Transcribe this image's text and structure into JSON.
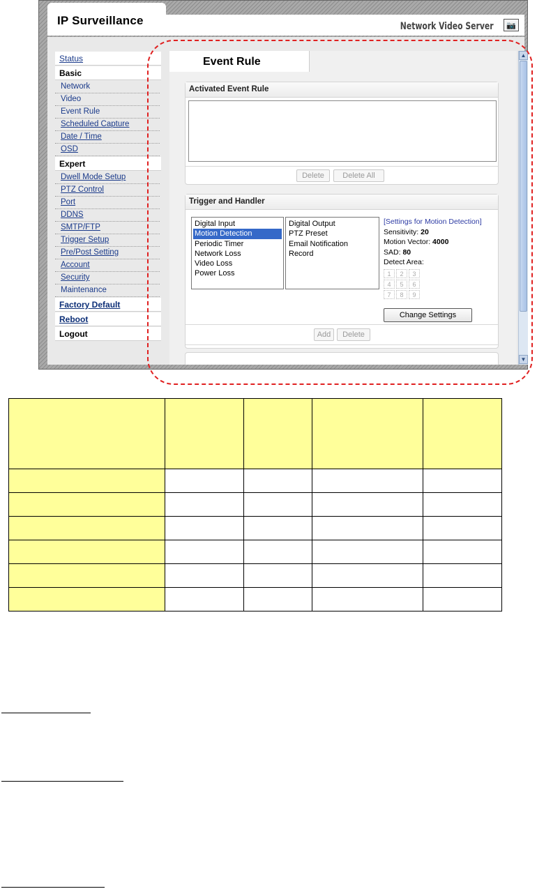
{
  "app": {
    "title": "IP Surveillance",
    "product": "Network Video Server",
    "camera_icon": "camera-icon"
  },
  "sidebar": {
    "status": "Status",
    "basic": "Basic",
    "basic_items": [
      "Network",
      "Video",
      "Event Rule",
      "Scheduled Capture",
      "Date / Time",
      "OSD"
    ],
    "expert": "Expert",
    "expert_items": [
      "Dwell Mode Setup",
      "PTZ Control",
      "Port",
      "DDNS",
      "SMTP/FTP",
      "Trigger Setup",
      "Pre/Post Setting",
      "Account",
      "Security",
      "Maintenance"
    ],
    "factory_default": "Factory Default",
    "reboot": "Reboot",
    "logout": "Logout"
  },
  "main": {
    "page_title": "Event Rule",
    "activated": {
      "heading": "Activated Event Rule",
      "delete_label": "Delete",
      "delete_all_label": "Delete All"
    },
    "trigger": {
      "heading": "Trigger and Handler",
      "triggers": [
        "Digital Input",
        "Motion Detection",
        "Periodic Timer",
        "Network Loss",
        "Video Loss",
        "Power Loss"
      ],
      "selected_trigger": "Motion Detection",
      "handlers": [
        "Digital Output",
        "PTZ Preset",
        "Email Notification",
        "Record"
      ],
      "settings_heading": "[Settings for Motion Detection]",
      "sensitivity_label": "Sensitivity:",
      "sensitivity_value": "20",
      "motion_vector_label": "Motion Vector:",
      "motion_vector_value": "4000",
      "sad_label": "SAD:",
      "sad_value": "80",
      "detect_area_label": "Detect Area:",
      "detect_area_cells": [
        "1",
        "2",
        "3",
        "4",
        "5",
        "6",
        "7",
        "8",
        "9"
      ],
      "change_settings_label": "Change Settings",
      "add_label": "Add",
      "delete_label": "Delete"
    }
  },
  "colors": {
    "highlight": "#e02020",
    "table_header": "#ffff9a",
    "selection": "#3569c8"
  }
}
